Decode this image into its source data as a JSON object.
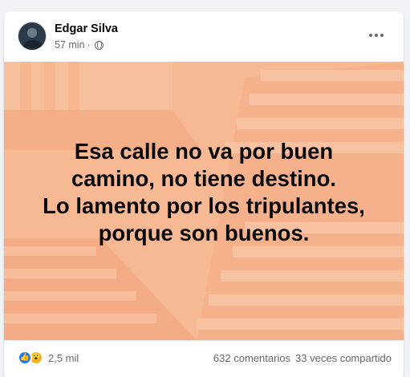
{
  "post": {
    "author": "Edgar Silva",
    "time": "57 min",
    "separator": "·",
    "privacy_icon": "globe-icon",
    "menu_icon": "more-options-icon"
  },
  "image": {
    "background_color": "#f5b792",
    "quote": "Esa calle no va por buen\ncamino, no tiene destino.\nLo lamento por los tripulantes,\nporque son buenos."
  },
  "footer": {
    "reaction_icons": [
      "like-reaction-icon",
      "wow-reaction-icon"
    ],
    "reaction_count": "2,5 mil",
    "comments": "632 comentarios",
    "shares": "33 veces compartido"
  }
}
